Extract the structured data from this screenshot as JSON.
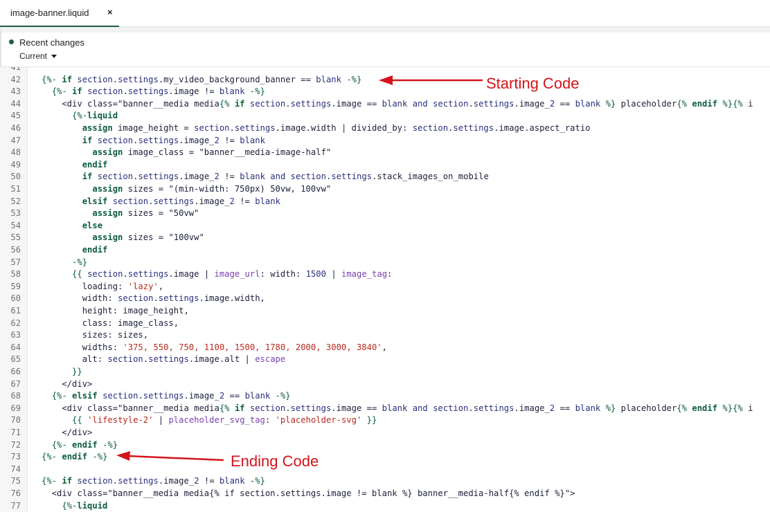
{
  "tab": {
    "label": "image-banner.liquid",
    "close": "×"
  },
  "history": {
    "title": "Recent changes",
    "version": "Current"
  },
  "annotations": {
    "start": "Starting Code",
    "end": "Ending Code"
  },
  "colors": {
    "accent": "#1f5c4a",
    "annotation": "#d3141a"
  },
  "lines": [
    {
      "n": "41",
      "t": ""
    },
    {
      "n": "42",
      "t": "{%- if section.settings.my_video_background_banner == blank -%}"
    },
    {
      "n": "43",
      "t": "  {%- if section.settings.image != blank -%}"
    },
    {
      "n": "44",
      "t": "    <div class=\"banner__media media{% if section.settings.image == blank and section.settings.image_2 == blank %} placeholder{% endif %}{% i"
    },
    {
      "n": "45",
      "t": "      {%-liquid"
    },
    {
      "n": "46",
      "t": "        assign image_height = section.settings.image.width | divided_by: section.settings.image.aspect_ratio"
    },
    {
      "n": "47",
      "t": "        if section.settings.image_2 != blank"
    },
    {
      "n": "48",
      "t": "          assign image_class = \"banner__media-image-half\""
    },
    {
      "n": "49",
      "t": "        endif"
    },
    {
      "n": "50",
      "t": "        if section.settings.image_2 != blank and section.settings.stack_images_on_mobile"
    },
    {
      "n": "51",
      "t": "          assign sizes = \"(min-width: 750px) 50vw, 100vw\""
    },
    {
      "n": "52",
      "t": "        elsif section.settings.image_2 != blank"
    },
    {
      "n": "53",
      "t": "          assign sizes = \"50vw\""
    },
    {
      "n": "54",
      "t": "        else"
    },
    {
      "n": "55",
      "t": "          assign sizes = \"100vw\""
    },
    {
      "n": "56",
      "t": "        endif"
    },
    {
      "n": "57",
      "t": "      -%}"
    },
    {
      "n": "58",
      "t": "      {{ section.settings.image | image_url: width: 1500 | image_tag:"
    },
    {
      "n": "59",
      "t": "        loading: 'lazy',"
    },
    {
      "n": "60",
      "t": "        width: section.settings.image.width,"
    },
    {
      "n": "61",
      "t": "        height: image_height,"
    },
    {
      "n": "62",
      "t": "        class: image_class,"
    },
    {
      "n": "63",
      "t": "        sizes: sizes,"
    },
    {
      "n": "64",
      "t": "        widths: '375, 550, 750, 1100, 1500, 1780, 2000, 3000, 3840',"
    },
    {
      "n": "65",
      "t": "        alt: section.settings.image.alt | escape"
    },
    {
      "n": "66",
      "t": "      }}"
    },
    {
      "n": "67",
      "t": "    </div>"
    },
    {
      "n": "68",
      "t": "  {%- elsif section.settings.image_2 == blank -%}"
    },
    {
      "n": "69",
      "t": "    <div class=\"banner__media media{% if section.settings.image == blank and section.settings.image_2 == blank %} placeholder{% endif %}{% i"
    },
    {
      "n": "70",
      "t": "      {{ 'lifestyle-2' | placeholder_svg_tag: 'placeholder-svg' }}"
    },
    {
      "n": "71",
      "t": "    </div>"
    },
    {
      "n": "72",
      "t": "  {%- endif -%}"
    },
    {
      "n": "73",
      "t": "{%- endif -%}"
    },
    {
      "n": "74",
      "t": ""
    },
    {
      "n": "75",
      "t": "{%- if section.settings.image_2 != blank -%}"
    },
    {
      "n": "76",
      "t": "  <div class=\"banner__media media{% if section.settings.image != blank %} banner__media-half{% endif %}\">"
    },
    {
      "n": "77",
      "t": "    {%-liquid"
    }
  ]
}
